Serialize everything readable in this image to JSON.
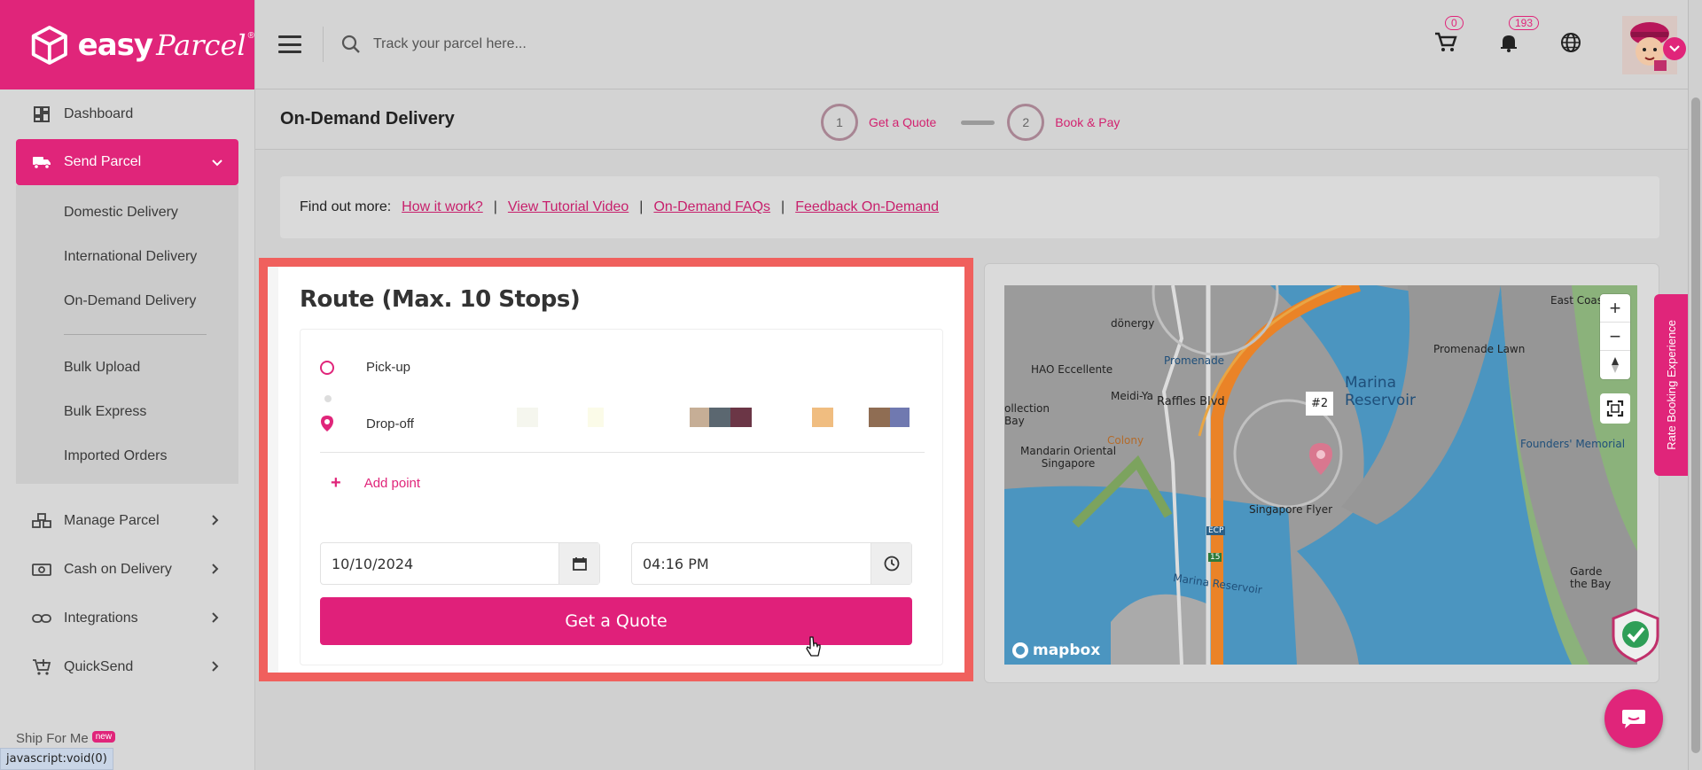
{
  "brand": {
    "name_bold": "easy",
    "name_script": "Parcel",
    "registered": "®",
    "accent": "#e0257a"
  },
  "sidebar": {
    "items": [
      {
        "label": "Dashboard",
        "icon": "dashboard-icon"
      },
      {
        "label": "Send Parcel",
        "icon": "truck-icon",
        "active": true
      },
      {
        "label": "Manage Parcel",
        "icon": "boxes-icon"
      },
      {
        "label": "Cash on Delivery",
        "icon": "cash-icon"
      },
      {
        "label": "Integrations",
        "icon": "link-icon"
      },
      {
        "label": "QuickSend",
        "icon": "cart-plus-icon"
      }
    ],
    "send_parcel_sub": [
      "Domestic Delivery",
      "International Delivery",
      "On-Demand Delivery",
      "Bulk Upload",
      "Bulk Express",
      "Imported Orders"
    ],
    "ship_for_me": "Ship For Me",
    "ship_for_me_badge": "new"
  },
  "status_bar_url": "javascript:void(0)",
  "header": {
    "search_placeholder": "Track your parcel here...",
    "cart_count": "0",
    "notification_count": "193"
  },
  "page": {
    "title": "On-Demand Delivery",
    "steps": [
      {
        "num": "1",
        "label": "Get a Quote"
      },
      {
        "num": "2",
        "label": "Book & Pay"
      }
    ],
    "find_out_more": "Find out more:",
    "links": [
      "How it work?",
      "View Tutorial Video",
      "On-Demand FAQs",
      "Feedback On-Demand"
    ],
    "separator": "|"
  },
  "route": {
    "title": "Route (Max. 10 Stops)",
    "pickup_label": "Pick-up",
    "dropoff_label": "Drop-off",
    "add_point": "Add point",
    "date": "10/10/2024",
    "time": "04:16 PM",
    "submit": "Get a Quote"
  },
  "map": {
    "attribution": "mapbox",
    "marker_label": "#2",
    "labels": {
      "donergy": "dönergy",
      "promenade": "Promenade",
      "hao": "HAO Eccellente",
      "meidi": "Meidi-Ya",
      "raffles": "Raffles Blvd",
      "marina_reservoir": "Marina\nReservoir",
      "colony": "Colony",
      "collection": "ollection\nBay",
      "mandarin": "Mandarin Oriental\nSingapore",
      "flyer": "Singapore Flyer",
      "promenade_lawn": "Promenade Lawn",
      "east_coast": "East Coas",
      "founders": "Founders' Memorial",
      "marina_reservoir_water": "Marina Reservoir",
      "garden": "Garde\nthe Bay",
      "ecp": "ECP",
      "route15": "15"
    }
  },
  "rate_booking": "Rate Booking Experience"
}
